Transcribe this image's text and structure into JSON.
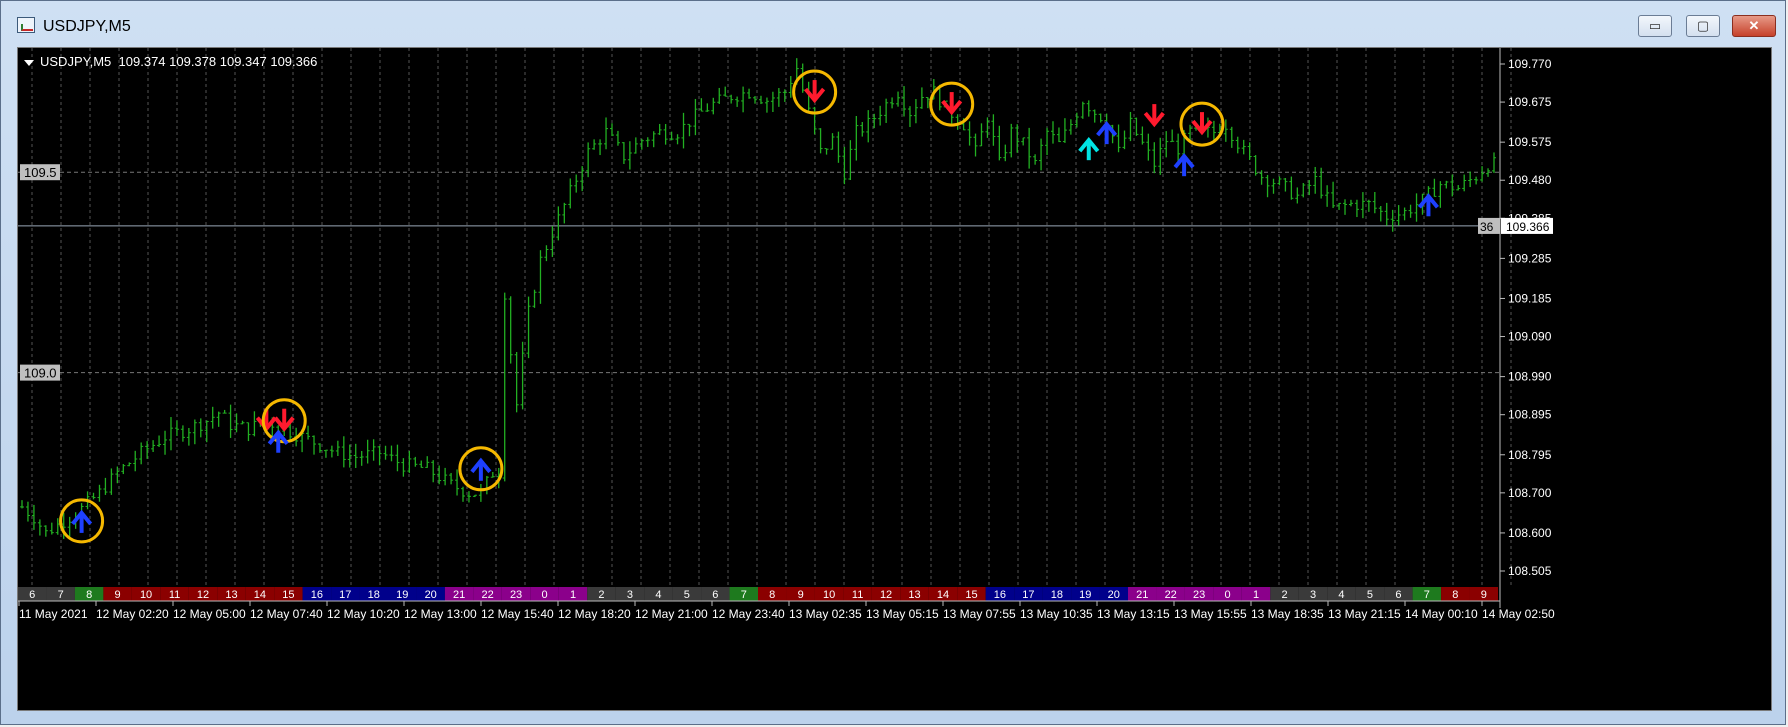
{
  "window": {
    "title": "USDJPY,M5",
    "buttons": {
      "minimize": "▭",
      "maximize": "▢",
      "close": "✕"
    }
  },
  "chart_header": {
    "symbol": "USDJPY,M5",
    "ohlc": "109.374 109.378 109.347 109.366"
  },
  "chart_data": {
    "type": "bar",
    "symbol": "USDJPY",
    "timeframe": "M5",
    "ylim": [
      108.505,
      109.77
    ],
    "y_ticks": [
      "109.770",
      "109.675",
      "109.575",
      "109.480",
      "109.385",
      "109.285",
      "109.185",
      "109.090",
      "108.990",
      "108.895",
      "108.795",
      "108.700",
      "108.600",
      "108.505"
    ],
    "level_labels": [
      {
        "label": "109.5",
        "value": 109.5
      },
      {
        "label": "109.0",
        "value": 109.0
      }
    ],
    "current_price": "109.366",
    "current_price_tag_left": "36",
    "time_labels": [
      "11 May 2021",
      "12 May 02:20",
      "12 May 05:00",
      "12 May 07:40",
      "12 May 10:20",
      "12 May 13:00",
      "12 May 15:40",
      "12 May 18:20",
      "12 May 21:00",
      "12 May 23:40",
      "13 May 02:35",
      "13 May 05:15",
      "13 May 07:55",
      "13 May 10:35",
      "13 May 13:15",
      "13 May 15:55",
      "13 May 18:35",
      "13 May 21:15",
      "14 May 00:10",
      "14 May 02:50"
    ],
    "hour_strip": {
      "labels": [
        "6",
        "7",
        "8",
        "9",
        "10",
        "11",
        "12",
        "13",
        "14",
        "15",
        "16",
        "17",
        "18",
        "19",
        "20",
        "21",
        "22",
        "23",
        "0",
        "1",
        "2",
        "3",
        "4",
        "5",
        "6",
        "7",
        "8",
        "9",
        "10",
        "11",
        "12",
        "13",
        "14",
        "15",
        "16",
        "17",
        "18",
        "19",
        "20",
        "21",
        "22",
        "23",
        "0",
        "1",
        "2",
        "3",
        "4",
        "5",
        "6",
        "7",
        "8",
        "9"
      ],
      "colors": [
        "#3a3a3a",
        "#3a3a3a",
        "#1e7a1e",
        "#8b0000",
        "#8b0000",
        "#8b0000",
        "#8b0000",
        "#8b0000",
        "#8b0000",
        "#8b0000",
        "#00008b",
        "#00008b",
        "#00008b",
        "#00008b",
        "#00008b",
        "#8b008b",
        "#8b008b",
        "#8b008b",
        "#8b008b",
        "#8b008b",
        "#3a3a3a",
        "#3a3a3a",
        "#3a3a3a",
        "#3a3a3a",
        "#3a3a3a",
        "#1e7a1e",
        "#8b0000",
        "#8b0000",
        "#8b0000",
        "#8b0000",
        "#8b0000",
        "#8b0000",
        "#8b0000",
        "#8b0000",
        "#00008b",
        "#00008b",
        "#00008b",
        "#00008b",
        "#00008b",
        "#8b008b",
        "#8b008b",
        "#8b008b",
        "#8b008b",
        "#8b008b",
        "#3a3a3a",
        "#3a3a3a",
        "#3a3a3a",
        "#3a3a3a",
        "#3a3a3a",
        "#1e7a1e",
        "#8b0000",
        "#8b0000"
      ]
    },
    "price_path": [
      [
        0,
        108.665
      ],
      [
        2,
        108.64
      ],
      [
        4,
        108.6
      ],
      [
        7,
        108.63
      ],
      [
        10,
        108.66
      ],
      [
        13,
        108.7
      ],
      [
        16,
        108.75
      ],
      [
        20,
        108.8
      ],
      [
        24,
        108.84
      ],
      [
        28,
        108.86
      ],
      [
        31,
        108.88
      ],
      [
        33,
        108.9
      ],
      [
        35,
        108.87
      ],
      [
        38,
        108.86
      ],
      [
        41,
        108.88
      ],
      [
        44,
        108.86
      ],
      [
        47,
        108.84
      ],
      [
        50,
        108.82
      ],
      [
        53,
        108.8
      ],
      [
        56,
        108.79
      ],
      [
        60,
        108.8
      ],
      [
        64,
        108.77
      ],
      [
        68,
        108.76
      ],
      [
        72,
        108.72
      ],
      [
        75,
        108.7
      ],
      [
        77,
        108.7
      ],
      [
        79,
        108.75
      ],
      [
        80,
        108.75
      ],
      [
        81,
        109.2
      ],
      [
        82,
        109.05
      ],
      [
        83,
        108.92
      ],
      [
        85,
        109.15
      ],
      [
        87,
        109.28
      ],
      [
        89,
        109.35
      ],
      [
        92,
        109.45
      ],
      [
        95,
        109.55
      ],
      [
        98,
        109.6
      ],
      [
        101,
        109.54
      ],
      [
        104,
        109.58
      ],
      [
        107,
        109.6
      ],
      [
        110,
        109.6
      ],
      [
        113,
        109.64
      ],
      [
        116,
        109.67
      ],
      [
        119,
        109.69
      ],
      [
        122,
        109.7
      ],
      [
        125,
        109.68
      ],
      [
        128,
        109.7
      ],
      [
        130,
        109.76
      ],
      [
        132,
        109.65
      ],
      [
        134,
        109.55
      ],
      [
        136,
        109.58
      ],
      [
        138,
        109.5
      ],
      [
        140,
        109.6
      ],
      [
        142,
        109.62
      ],
      [
        145,
        109.67
      ],
      [
        147,
        109.7
      ],
      [
        149,
        109.65
      ],
      [
        151,
        109.69
      ],
      [
        153,
        109.7
      ],
      [
        155,
        109.66
      ],
      [
        158,
        109.62
      ],
      [
        160,
        109.55
      ],
      [
        162,
        109.64
      ],
      [
        164,
        109.52
      ],
      [
        166,
        109.6
      ],
      [
        168,
        109.57
      ],
      [
        170,
        109.52
      ],
      [
        172,
        109.6
      ],
      [
        174,
        109.57
      ],
      [
        176,
        109.62
      ],
      [
        178,
        109.68
      ],
      [
        180,
        109.65
      ],
      [
        182,
        109.63
      ],
      [
        184,
        109.55
      ],
      [
        186,
        109.62
      ],
      [
        188,
        109.57
      ],
      [
        190,
        109.52
      ],
      [
        192,
        109.58
      ],
      [
        194,
        109.56
      ],
      [
        196,
        109.6
      ],
      [
        198,
        109.6
      ],
      [
        200,
        109.6
      ],
      [
        202,
        109.62
      ],
      [
        205,
        109.55
      ],
      [
        208,
        109.49
      ],
      [
        211,
        109.47
      ],
      [
        214,
        109.44
      ],
      [
        217,
        109.48
      ],
      [
        220,
        109.41
      ],
      [
        223,
        109.42
      ],
      [
        226,
        109.42
      ],
      [
        229,
        109.39
      ],
      [
        232,
        109.4
      ],
      [
        235,
        109.43
      ],
      [
        238,
        109.47
      ],
      [
        241,
        109.46
      ],
      [
        244,
        109.49
      ],
      [
        246,
        109.52
      ]
    ],
    "signals": [
      {
        "dir": "up",
        "color": "#1e40ff",
        "x": 10,
        "y": 108.63,
        "circled": true
      },
      {
        "dir": "down",
        "color": "#ff1a2e",
        "x": 41,
        "y": 108.88,
        "circled": false
      },
      {
        "dir": "down",
        "color": "#ff1a2e",
        "x": 44,
        "y": 108.88,
        "circled": true
      },
      {
        "dir": "up",
        "color": "#1e40ff",
        "x": 43,
        "y": 108.83,
        "circled": false
      },
      {
        "dir": "up",
        "color": "#1e40ff",
        "x": 77,
        "y": 108.76,
        "circled": true
      },
      {
        "dir": "down",
        "color": "#ff1a2e",
        "x": 133,
        "y": 109.7,
        "circled": true
      },
      {
        "dir": "down",
        "color": "#ff1a2e",
        "x": 156,
        "y": 109.67,
        "circled": true
      },
      {
        "dir": "up",
        "color": "#1e40ff",
        "x": 182,
        "y": 109.6,
        "circled": false
      },
      {
        "dir": "up",
        "color": "#00e5e5",
        "x": 179,
        "y": 109.56,
        "circled": false
      },
      {
        "dir": "down",
        "color": "#ff1a2e",
        "x": 190,
        "y": 109.64,
        "circled": false
      },
      {
        "dir": "down",
        "color": "#ff1a2e",
        "x": 198,
        "y": 109.62,
        "circled": true
      },
      {
        "dir": "up",
        "color": "#1e40ff",
        "x": 195,
        "y": 109.52,
        "circled": false
      },
      {
        "dir": "up",
        "color": "#1e40ff",
        "x": 236,
        "y": 109.42,
        "circled": false
      }
    ],
    "colors": {
      "bars": "#22b022",
      "background": "#000000",
      "grid": "#555555",
      "circle": "#f5b800"
    },
    "grid": true
  }
}
